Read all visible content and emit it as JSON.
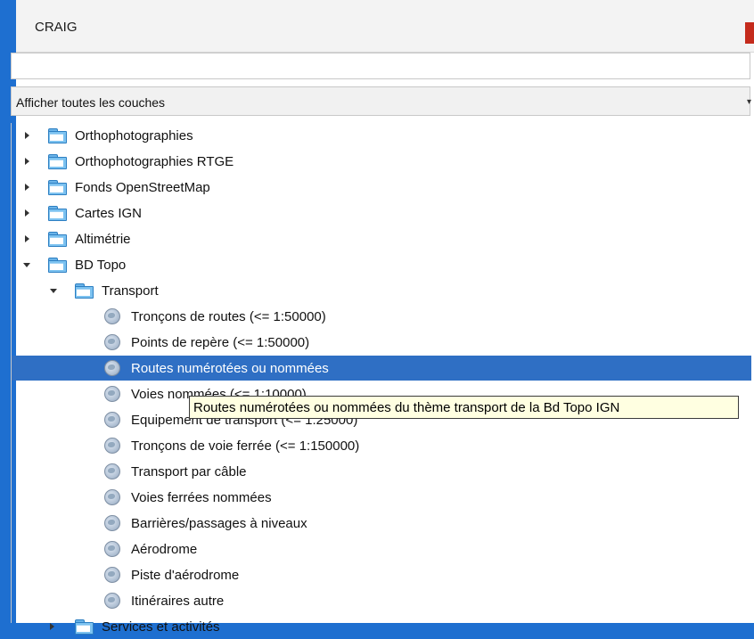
{
  "window": {
    "title": "CRAIG"
  },
  "search": {
    "value": "",
    "placeholder": ""
  },
  "filter": {
    "selected": "Afficher toutes les couches",
    "caret": "▾"
  },
  "tree": {
    "groups": [
      {
        "label": "Orthophotographies",
        "expanded": false
      },
      {
        "label": "Orthophotographies RTGE",
        "expanded": false
      },
      {
        "label": "Fonds OpenStreetMap",
        "expanded": false
      },
      {
        "label": "Cartes IGN",
        "expanded": false
      },
      {
        "label": "Altimétrie",
        "expanded": false
      },
      {
        "label": "BD Topo",
        "expanded": true
      }
    ],
    "subgroup": {
      "label": "Transport",
      "expanded": true
    },
    "layers": [
      {
        "label": "Tronçons de routes (<= 1:50000)"
      },
      {
        "label": "Points de repère (<= 1:50000)"
      },
      {
        "label": "Routes numérotées ou nommées",
        "selected": true
      },
      {
        "label": "Voies nommées (<= 1:10000)"
      },
      {
        "label": "Equipement de transport (<= 1:25000)"
      },
      {
        "label": "Tronçons de voie ferrée (<= 1:150000)"
      },
      {
        "label": "Transport par câble"
      },
      {
        "label": "Voies ferrées nommées"
      },
      {
        "label": "Barrières/passages à niveaux"
      },
      {
        "label": "Aérodrome"
      },
      {
        "label": "Piste d'aérodrome"
      },
      {
        "label": "Itinéraires autre"
      }
    ],
    "partial_group": {
      "label": "Services et activités"
    }
  },
  "tooltip": {
    "text": "Routes numérotées ou nommées du thème transport de la Bd Topo IGN"
  },
  "colors": {
    "selection": "#2f6fc4",
    "window_bg": "#1e6fd0",
    "tooltip_bg": "#ffffe1"
  }
}
